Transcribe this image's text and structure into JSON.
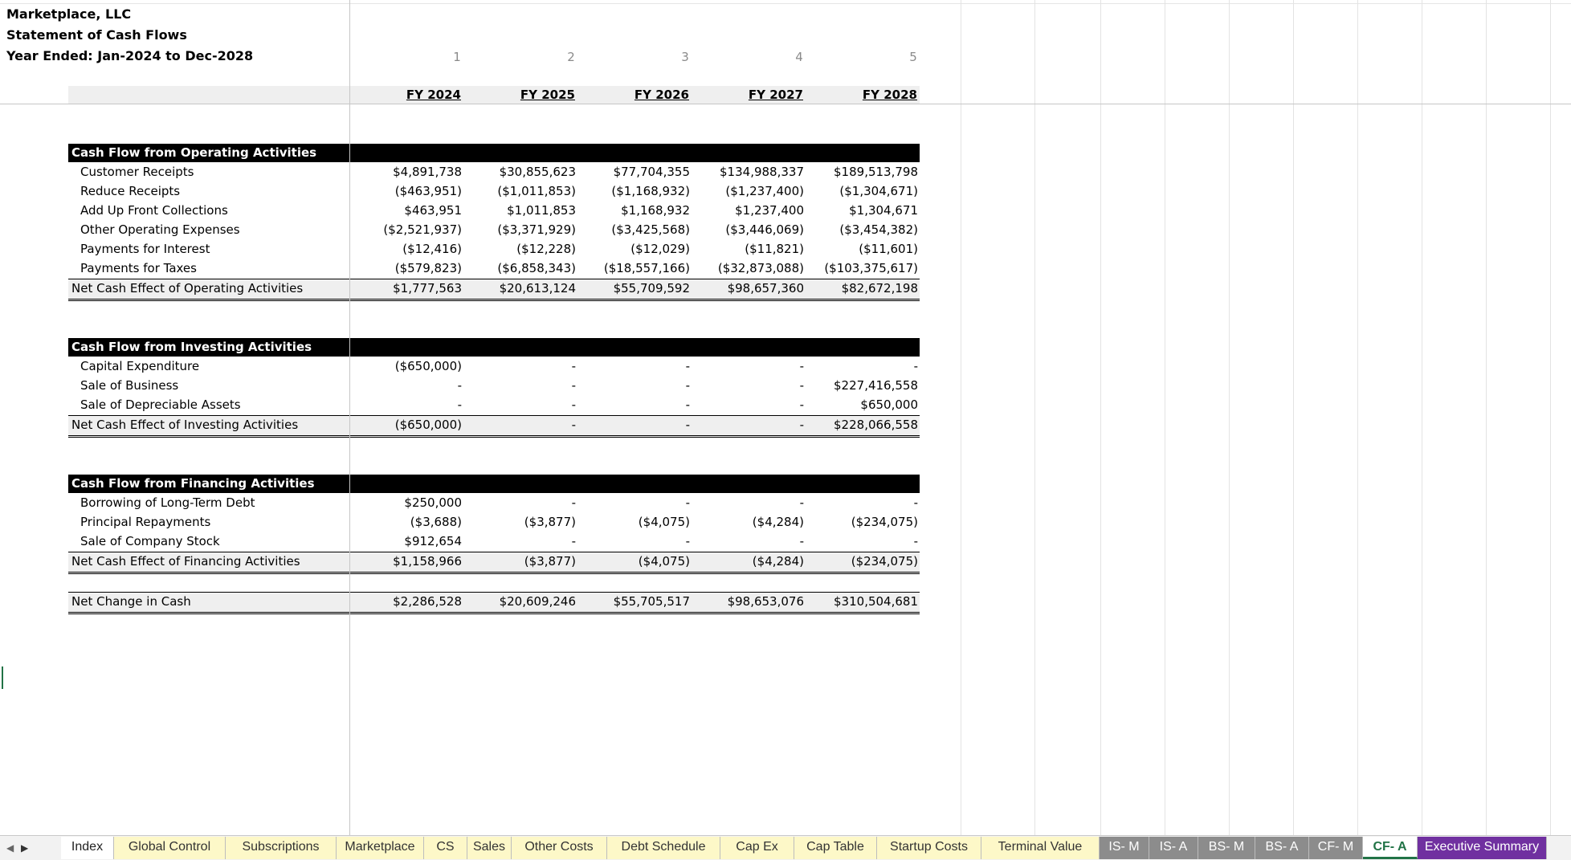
{
  "company": "Marketplace, LLC",
  "statement": "Statement of Cash Flows",
  "period": "Year Ended: Jan-2024 to Dec-2028",
  "column_numbers": [
    "1",
    "2",
    "3",
    "4",
    "5"
  ],
  "fiscal_years": [
    "FY 2024",
    "FY 2025",
    "FY 2026",
    "FY 2027",
    "FY 2028"
  ],
  "sections": {
    "operating": {
      "title": "Cash Flow from Operating Activities",
      "rows": [
        {
          "label": "Customer Receipts",
          "values": [
            "$4,891,738",
            "$30,855,623",
            "$77,704,355",
            "$134,988,337",
            "$189,513,798"
          ]
        },
        {
          "label": "Reduce Receipts",
          "values": [
            "($463,951)",
            "($1,011,853)",
            "($1,168,932)",
            "($1,237,400)",
            "($1,304,671)"
          ]
        },
        {
          "label": "Add Up Front Collections",
          "values": [
            "$463,951",
            "$1,011,853",
            "$1,168,932",
            "$1,237,400",
            "$1,304,671"
          ]
        },
        {
          "label": "Other Operating Expenses",
          "values": [
            "($2,521,937)",
            "($3,371,929)",
            "($3,425,568)",
            "($3,446,069)",
            "($3,454,382)"
          ]
        },
        {
          "label": "Payments for Interest",
          "values": [
            "($12,416)",
            "($12,228)",
            "($12,029)",
            "($11,821)",
            "($11,601)"
          ]
        },
        {
          "label": "Payments for Taxes",
          "values": [
            "($579,823)",
            "($6,858,343)",
            "($18,557,166)",
            "($32,873,088)",
            "($103,375,617)"
          ]
        }
      ],
      "total": {
        "label": "Net Cash Effect of Operating Activities",
        "values": [
          "$1,777,563",
          "$20,613,124",
          "$55,709,592",
          "$98,657,360",
          "$82,672,198"
        ]
      }
    },
    "investing": {
      "title": "Cash Flow from Investing Activities",
      "rows": [
        {
          "label": "Capital Expenditure",
          "values": [
            "($650,000)",
            "-",
            "-",
            "-",
            "-"
          ]
        },
        {
          "label": "Sale of Business",
          "values": [
            "-",
            "-",
            "-",
            "-",
            "$227,416,558"
          ]
        },
        {
          "label": "Sale of Depreciable Assets",
          "values": [
            "-",
            "-",
            "-",
            "-",
            "$650,000"
          ]
        }
      ],
      "total": {
        "label": "Net Cash Effect of Investing Activities",
        "values": [
          "($650,000)",
          "-",
          "-",
          "-",
          "$228,066,558"
        ]
      }
    },
    "financing": {
      "title": "Cash Flow from Financing Activities",
      "rows": [
        {
          "label": "Borrowing of Long-Term Debt",
          "values": [
            "$250,000",
            "-",
            "-",
            "-",
            "-"
          ]
        },
        {
          "label": "Principal Repayments",
          "values": [
            "($3,688)",
            "($3,877)",
            "($4,075)",
            "($4,284)",
            "($234,075)"
          ]
        },
        {
          "label": "Sale of Company Stock",
          "values": [
            "$912,654",
            "-",
            "-",
            "-",
            "-"
          ]
        }
      ],
      "total": {
        "label": "Net Cash Effect of Financing Activities",
        "values": [
          "$1,158,966",
          "($3,877)",
          "($4,075)",
          "($4,284)",
          "($234,075)"
        ]
      }
    }
  },
  "net_change": {
    "label": "Net Change in Cash",
    "values": [
      "$2,286,528",
      "$20,609,246",
      "$55,705,517",
      "$98,653,076",
      "$310,504,681"
    ]
  },
  "sheet_tabs": [
    {
      "label": "Index",
      "style": "white"
    },
    {
      "label": "Global Control",
      "style": "yellow"
    },
    {
      "label": "Subscriptions",
      "style": "yellow"
    },
    {
      "label": "Marketplace",
      "style": "yellow"
    },
    {
      "label": "CS",
      "style": "yellow"
    },
    {
      "label": "Sales",
      "style": "yellow"
    },
    {
      "label": "Other Costs",
      "style": "yellow"
    },
    {
      "label": "Debt Schedule",
      "style": "yellow"
    },
    {
      "label": "Cap Ex",
      "style": "yellow"
    },
    {
      "label": "Cap Table",
      "style": "yellow"
    },
    {
      "label": "Startup Costs",
      "style": "yellow"
    },
    {
      "label": "Terminal Value",
      "style": "yellow"
    },
    {
      "label": "IS- M",
      "style": "gray"
    },
    {
      "label": "IS- A",
      "style": "gray"
    },
    {
      "label": "BS- M",
      "style": "gray"
    },
    {
      "label": "BS- A",
      "style": "gray"
    },
    {
      "label": "CF- M",
      "style": "gray"
    },
    {
      "label": "CF- A",
      "style": "active"
    },
    {
      "label": "Executive Summary",
      "style": "purple"
    }
  ],
  "colors": {
    "section_bar": "#000000",
    "total_fill": "#efefef",
    "active_tab": "#217346",
    "summary_tab": "#7030a0",
    "input_tab": "#fdf8c8",
    "output_tab": "#8c8c8c"
  }
}
